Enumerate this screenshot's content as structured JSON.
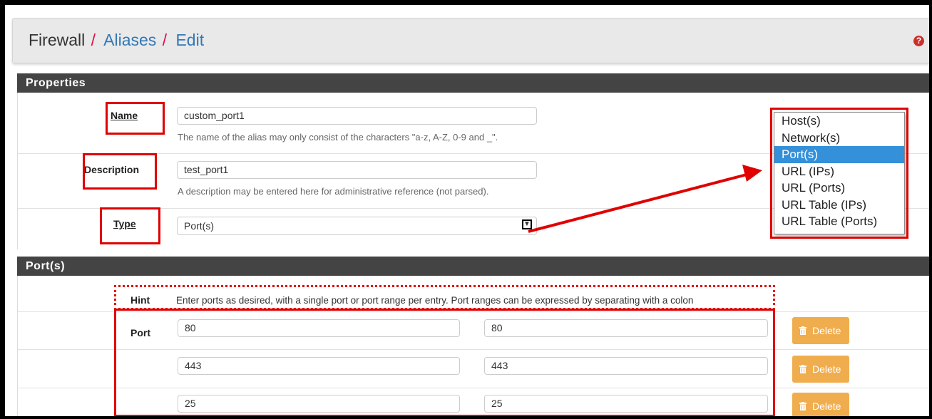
{
  "breadcrumb": {
    "root": "Firewall",
    "separator": "/",
    "aliases": "Aliases",
    "edit": "Edit"
  },
  "help_icon": "question-circle-icon",
  "properties": {
    "heading": "Properties",
    "name": {
      "label": "Name",
      "value": "custom_port1",
      "help": "The name of the alias may only consist of the characters \"a-z, A-Z, 0-9 and _\"."
    },
    "description": {
      "label": "Description",
      "value": "test_port1",
      "help": "A description may be entered here for administrative reference (not parsed)."
    },
    "type": {
      "label": "Type",
      "value": "Port(s)",
      "options": [
        "Host(s)",
        "Network(s)",
        "Port(s)",
        "URL (IPs)",
        "URL (Ports)",
        "URL Table (IPs)",
        "URL Table (Ports)"
      ],
      "selected_index": 2
    }
  },
  "ports": {
    "heading": "Port(s)",
    "hint_label": "Hint",
    "hint_text": "Enter ports as desired, with a single port or port range per entry. Port ranges can be expressed by separating with a colon",
    "port_label": "Port",
    "delete_label": "Delete",
    "rows": [
      {
        "port": "80",
        "description": "80"
      },
      {
        "port": "443",
        "description": "443"
      },
      {
        "port": "25",
        "description": "25"
      }
    ]
  },
  "colors": {
    "annotation": "#e00000",
    "panel_heading": "#444444",
    "link": "#3378b5",
    "delete_button": "#f0ad4e",
    "dropdown_selected": "#3390d9"
  }
}
